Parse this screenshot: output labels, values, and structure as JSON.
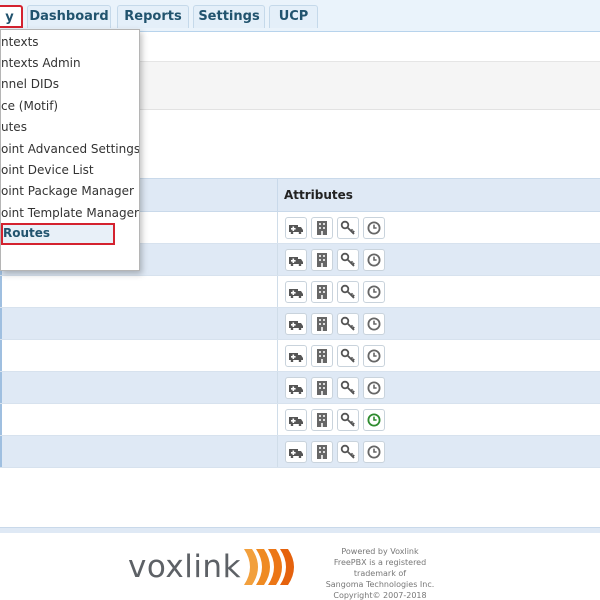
{
  "nav": {
    "tabs": [
      {
        "label": "Connectivity",
        "visible": "y",
        "active": true
      },
      {
        "label": "Dashboard"
      },
      {
        "label": "Reports"
      },
      {
        "label": "Settings"
      },
      {
        "label": "UCP"
      }
    ]
  },
  "dropdown": {
    "items": [
      {
        "label": "Contexts",
        "visible": "ntexts"
      },
      {
        "label": "Contexts Admin",
        "visible": "ntexts Admin"
      },
      {
        "label": "Channel DIDs",
        "visible": "nnel DIDs"
      },
      {
        "label": "Device (Motif)",
        "visible": "ce (Motif)"
      },
      {
        "label": "Routes",
        "visible": "utes"
      },
      {
        "label": "Endpoint Advanced Settings",
        "visible": "oint Advanced Settings"
      },
      {
        "label": "Endpoint Device List",
        "visible": "oint Device List"
      },
      {
        "label": "Endpoint Package Manager",
        "visible": "oint Package Manager"
      },
      {
        "label": "Endpoint Template Manager",
        "visible": "oint Template Manager"
      },
      {
        "label": "Outbound Routes",
        "visible": "Routes",
        "highlighted": true
      }
    ]
  },
  "table": {
    "header_attributes": "Attributes",
    "rows": [
      {
        "icons": [
          "emergency-icon",
          "building-icon",
          "key-icon",
          "clock-icon"
        ],
        "clock_color": "#666666"
      },
      {
        "icons": [
          "emergency-icon",
          "building-icon",
          "key-icon",
          "clock-icon"
        ],
        "clock_color": "#666666"
      },
      {
        "icons": [
          "emergency-icon",
          "building-icon",
          "key-icon",
          "clock-icon"
        ],
        "clock_color": "#666666"
      },
      {
        "icons": [
          "emergency-icon",
          "building-icon",
          "key-icon",
          "clock-icon"
        ],
        "clock_color": "#666666"
      },
      {
        "icons": [
          "emergency-icon",
          "building-icon",
          "key-icon",
          "clock-icon"
        ],
        "clock_color": "#666666"
      },
      {
        "icons": [
          "emergency-icon",
          "building-icon",
          "key-icon",
          "clock-icon"
        ],
        "clock_color": "#666666"
      },
      {
        "icons": [
          "emergency-icon",
          "building-icon",
          "key-icon",
          "clock-icon"
        ],
        "clock_color": "#2e8b2e"
      },
      {
        "icons": [
          "emergency-icon",
          "building-icon",
          "key-icon",
          "clock-icon"
        ],
        "clock_color": "#666666"
      }
    ]
  },
  "footer": {
    "logo": "voxlink",
    "powered_by": "Powered by Voxlink",
    "trademark_1": "FreePBX is a registered trademark of",
    "trademark_2": "Sangoma Technologies Inc.",
    "copyright": "Copyright© 2007-2018"
  },
  "colors": {
    "accent_red": "#d4222f",
    "nav_text": "#21536e",
    "row_alt": "#dfe9f5",
    "logo_orange": "#f07f1a"
  }
}
